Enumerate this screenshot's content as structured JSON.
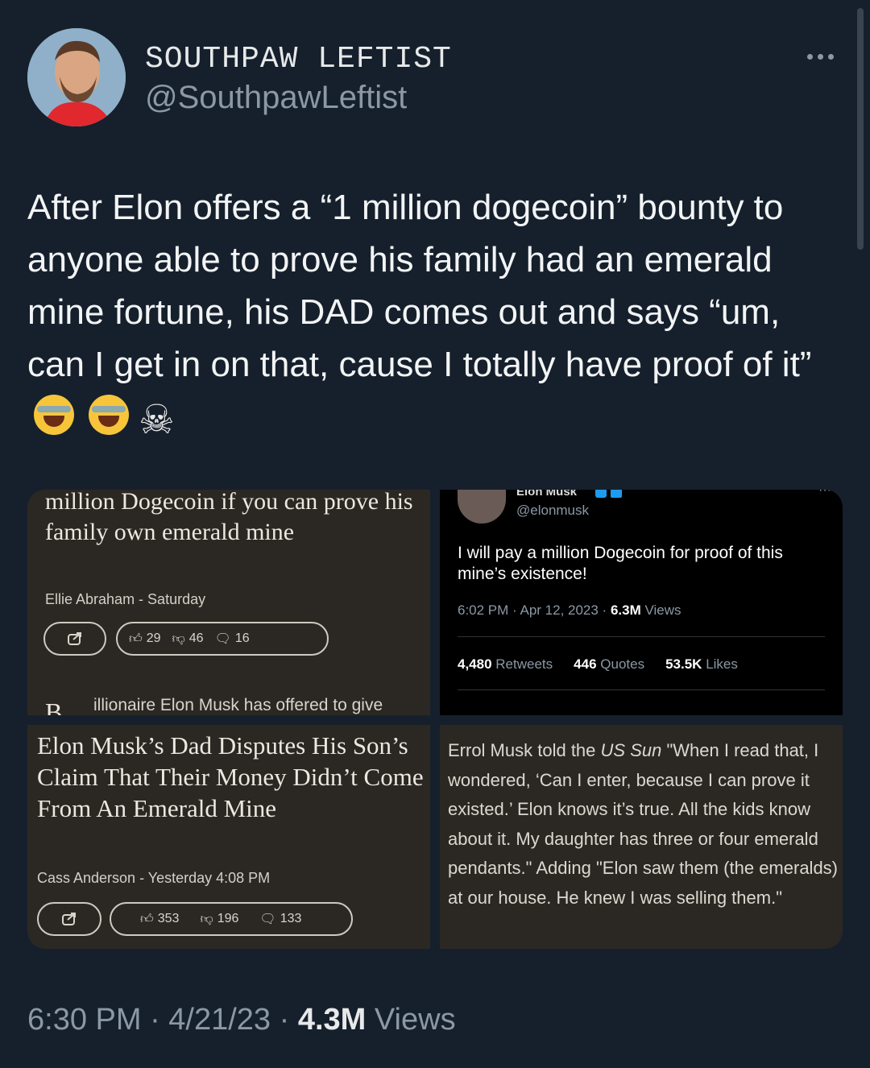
{
  "author": {
    "display_name": "SOUTHPAW LEFTIST",
    "handle": "@SouthpawLeftist"
  },
  "tweet": {
    "text": "After Elon offers a “1 million dogecoin” bounty to anyone able to prove his family had an emerald mine fortune, his DAD comes out and says “um, can I get in on that, cause I totally have proof of it”",
    "emojis": [
      "face-with-tears-of-joy",
      "face-with-tears-of-joy",
      "skull-and-crossbones"
    ]
  },
  "media": {
    "article1": {
      "headline": "million Dogecoin if you can prove his family own emerald mine",
      "byline": "Ellie Abraham - Saturday",
      "likes": "29",
      "dislikes": "46",
      "comments": "16",
      "drop_cap": "B",
      "body_start": "illionaire Elon Musk has offered to give"
    },
    "elon_tweet": {
      "name": "Elon Musk",
      "handle": "@elonmusk",
      "text": "I will pay a million Dogecoin for proof of this mine’s existence!",
      "time": "6:02 PM · Apr 12, 2023 · ",
      "views_count": "6.3M",
      "views_label": " Views",
      "retweets": "4,480",
      "retweets_label": "Retweets",
      "quotes": "446",
      "quotes_label": "Quotes",
      "likes": "53.5K",
      "likes_label": "Likes"
    },
    "article2": {
      "headline": "Elon Musk’s Dad Disputes His Son’s Claim That Their Money Didn’t Come From An Emerald Mine",
      "byline": "Cass Anderson - Yesterday 4:08 PM",
      "likes": "353",
      "dislikes": "196",
      "comments": "133"
    },
    "quote": {
      "pre": "Errol Musk told the ",
      "outlet": "US Sun",
      "post": " \"When I read that, I wondered, ‘Can I enter, because I can prove it existed.’ Elon knows it’s true. All the kids know about it. My daughter has three or four emerald pendants.\" Adding \"Elon saw them (the emeralds) at our house. He knew I was selling them.\""
    }
  },
  "footer": {
    "time": "6:30 PM · 4/21/23 · ",
    "views_count": "4.3M",
    "views_label": " Views"
  }
}
